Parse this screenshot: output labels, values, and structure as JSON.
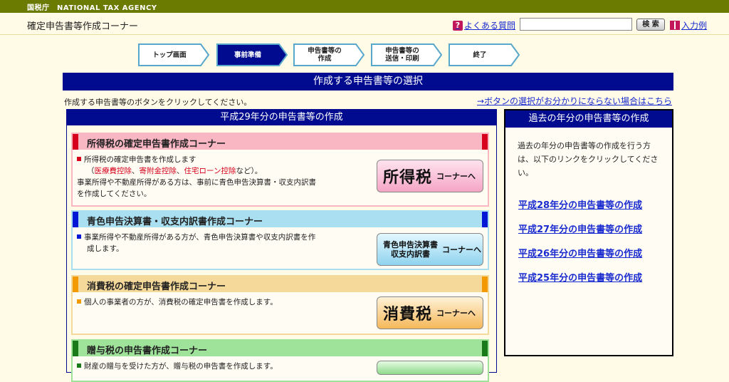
{
  "site": {
    "logo": "国税庁　NATIONAL TAX AGENCY",
    "title": "確定申告書等作成コーナー"
  },
  "header": {
    "faq_label": "よくある質問",
    "search_placeholder": "",
    "search_label": "検 索",
    "example_label": "入力例"
  },
  "steps": [
    {
      "label": "トップ画面",
      "active": false
    },
    {
      "label": "事前準備",
      "active": true
    },
    {
      "label": "申告書等の\n作成",
      "active": false
    },
    {
      "label": "申告書等の\n送信・印刷",
      "active": false
    },
    {
      "label": "終了",
      "active": false
    }
  ],
  "main": {
    "bar_title": "作成する申告書等の選択",
    "instruction": "作成する申告書等のボタンをクリックしてください。",
    "help_link": "→ボタンの選択がお分かりにならない場合はこちら"
  },
  "left_panel": {
    "title": "平成29年分の申告書等の作成",
    "corners": [
      {
        "title": "所得税の確定申告書作成コーナー",
        "line1": "所得税の確定申告書を作成します",
        "paren_open": "（",
        "deduction1": "医療費控除",
        "sep1": "、",
        "deduction2": "寄附金控除",
        "sep2": "、",
        "deduction3": "住宅ローン控除",
        "paren_close": "など）。",
        "line3": "事業所得や不動産所得がある方は、事前に青色申告決算書・収支内訳書",
        "line4": "を作成してください。",
        "button_big": "所得税",
        "button_small": "コーナーへ",
        "color": "#f9b6c3",
        "mark": "#d6001c"
      },
      {
        "title": "青色申告決算書・収支内訳書作成コーナー",
        "line1": "事業所得や不動産所得がある方が、青色申告決算書や収支内訳書を作",
        "line2": "成します。",
        "button_top": "青色申告決算書",
        "button_bottom": "収支内訳書",
        "button_small": "コーナーへ",
        "color": "#a9dff0",
        "mark": "#0018d6"
      },
      {
        "title": "消費税の確定申告書作成コーナー",
        "line1": "個人の事業者の方が、消費税の確定申告書を作成します。",
        "button_big": "消費税",
        "button_small": "コーナーへ",
        "color": "#f5d99a",
        "mark": "#f29a00"
      },
      {
        "title": "贈与税の申告書作成コーナー",
        "line1": "財産の贈与を受けた方が、贈与税の申告書を作成します。",
        "color": "#9fe39a",
        "mark": "#1a7a1a"
      }
    ]
  },
  "right_panel": {
    "title": "過去の年分の申告書等の作成",
    "description": "過去の年分の申告書等の作成を行う方は、以下のリンクをクリックしてください。",
    "links": [
      "平成28年分の申告書等の作成",
      "平成27年分の申告書等の作成",
      "平成26年分の申告書等の作成",
      "平成25年分の申告書等の作成"
    ]
  }
}
